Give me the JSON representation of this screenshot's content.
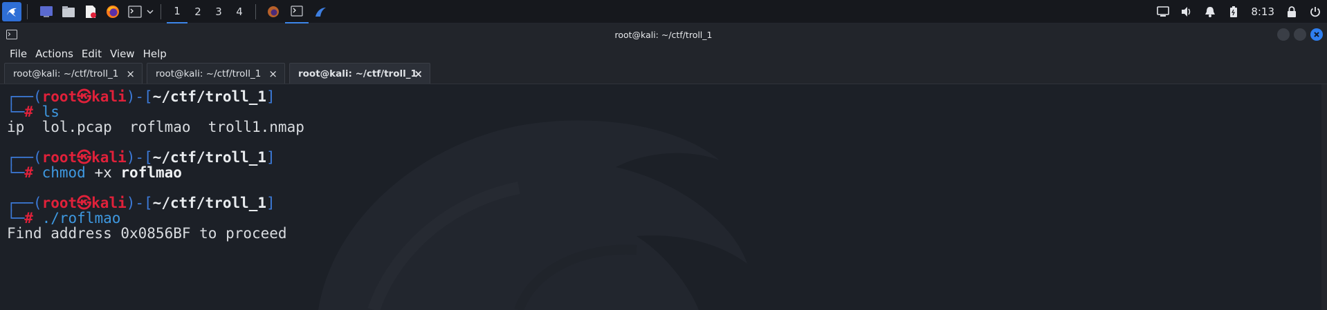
{
  "panel": {
    "workspaces": [
      "1",
      "2",
      "3",
      "4"
    ],
    "active_workspace": "1",
    "clock": "8:13",
    "icons": [
      "kali-menu-icon",
      "desktop-icon",
      "file-manager-icon",
      "text-editor-icon",
      "firefox-icon",
      "terminal-icon",
      "chevron-down-icon"
    ],
    "tray_icons": [
      "display-icon",
      "volume-icon",
      "notification-bell-icon",
      "battery-icon",
      "lock-icon",
      "power-icon"
    ]
  },
  "window": {
    "title": "root@kali: ~/ctf/troll_1",
    "menu": [
      "File",
      "Actions",
      "Edit",
      "View",
      "Help"
    ],
    "tabs": [
      {
        "label": "root@kali: ~/ctf/troll_1",
        "active": false
      },
      {
        "label": "root@kali: ~/ctf/troll_1",
        "active": false
      },
      {
        "label": "root@kali: ~/ctf/troll_1",
        "active": true
      }
    ],
    "tab_close": "×"
  },
  "terminal": {
    "user": "root",
    "host": "kali",
    "skull": "㉿",
    "cwd": "~/ctf/troll_1",
    "prompt_char": "#",
    "blocks": [
      {
        "cmd": "ls",
        "args": "",
        "bold_arg": "",
        "output": "ip  lol.pcap  roflmao  troll1.nmap"
      },
      {
        "cmd": "chmod",
        "args": " +x ",
        "bold_arg": "roflmao",
        "output": ""
      },
      {
        "cmd": "./roflmao",
        "args": "",
        "bold_arg": "",
        "output": "Find address 0x0856BF to proceed"
      }
    ]
  },
  "colors": {
    "accent": "#3d86ea",
    "prompt_red": "#e0213a",
    "prompt_blue": "#3c7ad8",
    "command_blue": "#3e98e0",
    "terminal_bg": "#1c2027"
  }
}
